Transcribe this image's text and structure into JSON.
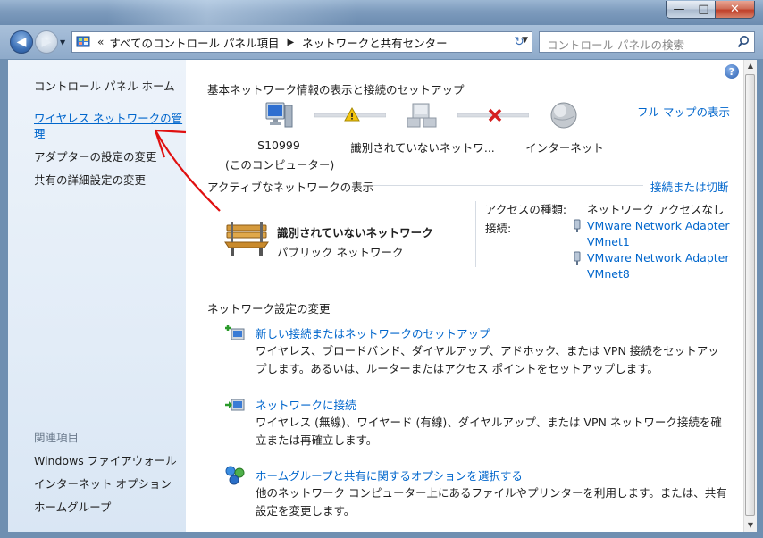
{
  "window": {
    "minimize": "—",
    "maximize": "□",
    "close": "✕"
  },
  "nav": {
    "back": "◀",
    "forward": "▶",
    "recent": "▼",
    "refresh": "↻",
    "breadcrumb_prefix": "«",
    "breadcrumb": [
      "すべてのコントロール パネル項目",
      "ネットワークと共有センター"
    ],
    "search_placeholder": "コントロール パネルの検索"
  },
  "sidebar": {
    "home": "コントロール パネル ホーム",
    "links": [
      "ワイヤレス ネットワークの管",
      "理",
      "アダプターの設定の変更",
      "共有の詳細設定の変更"
    ],
    "related_title": "関連項目",
    "related": [
      "Windows ファイアウォール",
      "インターネット オプション",
      "ホームグループ"
    ]
  },
  "main": {
    "help": "?",
    "section_title": "基本ネットワーク情報の表示と接続のセットアップ",
    "full_map": "フル マップの表示",
    "map_nodes": [
      {
        "label": "S10999",
        "sub": "(このコンピューター)"
      },
      {
        "label": "識別されていないネットワ..."
      },
      {
        "label": "インターネット"
      }
    ],
    "active_title": "アクティブなネットワークの表示",
    "connect_disconnect": "接続または切断",
    "network": {
      "name": "識別されていないネットワーク",
      "type": "パブリック ネットワーク",
      "access_label": "アクセスの種類:",
      "access_value": "ネットワーク アクセスなし",
      "conn_label": "接続:",
      "adapters": [
        {
          "line1": "VMware Network Adapter",
          "line2": "VMnet1"
        },
        {
          "line1": "VMware Network Adapter",
          "line2": "VMnet8"
        }
      ]
    },
    "change_title": "ネットワーク設定の変更",
    "tasks": [
      {
        "title": "新しい接続またはネットワークのセットアップ",
        "desc": "ワイヤレス、ブロードバンド、ダイヤルアップ、アドホック、または VPN 接続をセットアップします。あるいは、ルーターまたはアクセス ポイントをセットアップします。"
      },
      {
        "title": "ネットワークに接続",
        "desc": "ワイヤレス (無線)、ワイヤード (有線)、ダイヤルアップ、または VPN ネットワーク接続を確立または再確立します。"
      },
      {
        "title": "ホームグループと共有に関するオプションを選択する",
        "desc": "他のネットワーク コンピューター上にあるファイルやプリンターを利用します。または、共有設定を変更します。"
      }
    ]
  },
  "colors": {
    "link": "#0066cc",
    "arrow": "#e01010",
    "warning": "#f2c40f",
    "error": "#d42020"
  }
}
